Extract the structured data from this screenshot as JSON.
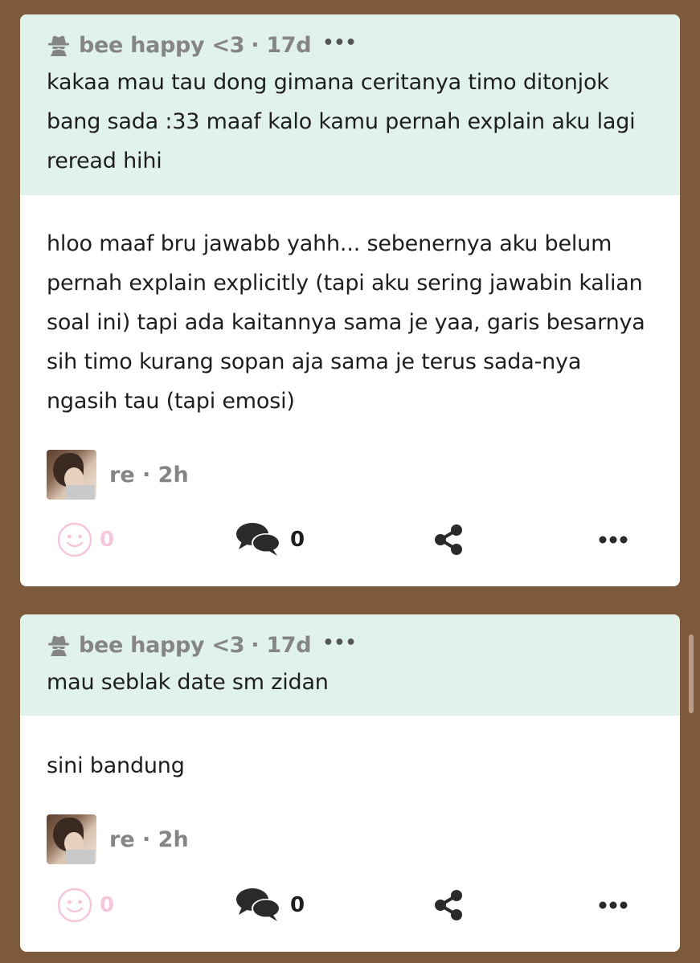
{
  "colors": {
    "background": "#7d5a3c",
    "question_bg": "#e1f2ea",
    "like_pink": "#f6c6dc",
    "muted_text": "#858585"
  },
  "posts": [
    {
      "asker": {
        "icon": "anonymous-spy-icon",
        "name": "bee happy <3",
        "time": "· 17d",
        "menu": "•••"
      },
      "question": "kakaa mau tau dong gimana ceritanya timo ditonjok bang sada :33 maaf kalo kamu pernah explain aku lagi reread hihi",
      "answer": "hloo maaf bru jawabb yahh... sebenernya aku belum pernah explain explicitly (tapi aku sering jawabin kalian soal ini) tapi ada kaitannya sama je yaa, garis besarnya sih timo kurang sopan aja sama je terus sada-nya ngasih tau (tapi emosi)",
      "author": "re · 2h",
      "likes": "0",
      "comments": "0"
    },
    {
      "asker": {
        "icon": "anonymous-spy-icon",
        "name": "bee happy <3",
        "time": "· 17d",
        "menu": "•••"
      },
      "question": "mau seblak date sm zidan",
      "answer": "sini bandung",
      "author": "re · 2h",
      "likes": "0",
      "comments": "0"
    }
  ]
}
